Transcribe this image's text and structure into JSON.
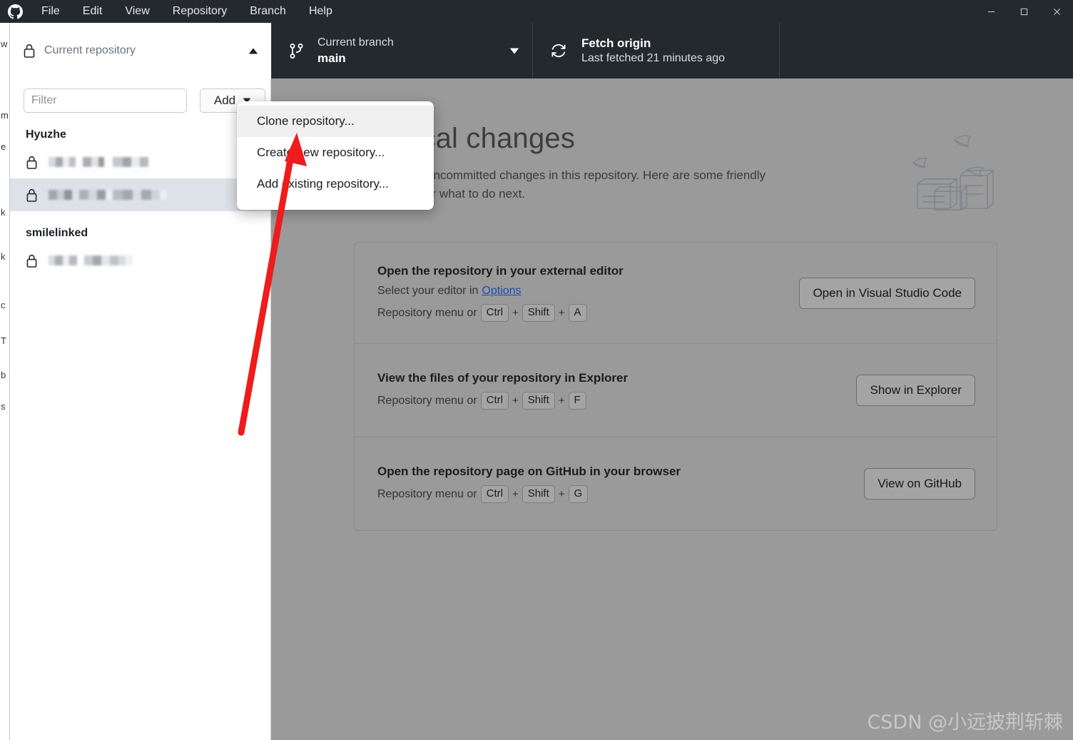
{
  "window": {
    "app_logo": "github-logo-icon",
    "menus": [
      "File",
      "Edit",
      "View",
      "Repository",
      "Branch",
      "Help"
    ],
    "controls": {
      "minimize": "minimize-icon",
      "maximize": "maximize-icon",
      "close": "close-icon"
    }
  },
  "toolbar": {
    "repository": {
      "lock_icon": "lock-icon",
      "label": "Current repository",
      "name": "",
      "caret": "chevron-up-icon"
    },
    "branch": {
      "icon": "branch-icon",
      "label": "Current branch",
      "name": "main",
      "caret": "chevron-down-icon"
    },
    "fetch": {
      "icon": "sync-icon",
      "title": "Fetch origin",
      "subtitle": "Last fetched 21 minutes ago"
    }
  },
  "sidebar": {
    "filter_placeholder": "Filter",
    "filter_value": "",
    "add_button": {
      "label": "Add",
      "caret": "chevron-down-icon"
    },
    "groups": [
      {
        "name": "Hyuzhe",
        "repos": [
          {
            "lock_icon": "lock-icon",
            "name": "",
            "selected": false,
            "blur_variant": "v1"
          },
          {
            "lock_icon": "lock-icon",
            "name": "",
            "selected": true,
            "blur_variant": "v2"
          }
        ]
      },
      {
        "name": "smilelinked",
        "repos": [
          {
            "lock_icon": "lock-icon",
            "name": "",
            "selected": false,
            "blur_variant": "v3"
          }
        ]
      }
    ]
  },
  "dropdown": {
    "visible": true,
    "items": [
      {
        "label": "Clone repository...",
        "hovered": true
      },
      {
        "label": "Create new repository...",
        "hovered": false
      },
      {
        "label": "Add existing repository...",
        "hovered": false
      }
    ]
  },
  "main": {
    "heading": "No local changes",
    "subtitle": "There are no uncommitted changes in this repository. Here are some friendly suggestions for what to do next.",
    "illustration": "empty-boxes-illustration",
    "cards": [
      {
        "title": "Open the repository in your external editor",
        "hint_prefix": "Select your editor in",
        "hint_link": "Options",
        "shortcut_prefix": "Repository menu or",
        "shortcut_keys": [
          "Ctrl",
          "Shift",
          "A"
        ],
        "button": "Open in Visual Studio Code"
      },
      {
        "title": "View the files of your repository in Explorer",
        "hint_prefix": "",
        "hint_link": "",
        "shortcut_prefix": "Repository menu or",
        "shortcut_keys": [
          "Ctrl",
          "Shift",
          "F"
        ],
        "button": "Show in Explorer"
      },
      {
        "title": "Open the repository page on GitHub in your browser",
        "hint_prefix": "",
        "hint_link": "",
        "shortcut_prefix": "Repository menu or",
        "shortcut_keys": [
          "Ctrl",
          "Shift",
          "G"
        ],
        "button": "View on GitHub"
      }
    ]
  },
  "annotation": {
    "arrow_color": "#ee1c1c",
    "points_to": "Clone repository..."
  },
  "watermark": {
    "text": "CSDN @小远披荆斩棘"
  },
  "background_window": {
    "fragments": [
      "w",
      "m",
      "e",
      "k",
      "k",
      "c",
      "T",
      "b",
      "s"
    ]
  },
  "colors": {
    "titlebar": "#24292e",
    "toolbar_dark": "#24292e",
    "panel": "#ffffff",
    "main_dimmed": "#9a9a9a",
    "link": "#1f4faa",
    "selection": "#dde2e8"
  }
}
